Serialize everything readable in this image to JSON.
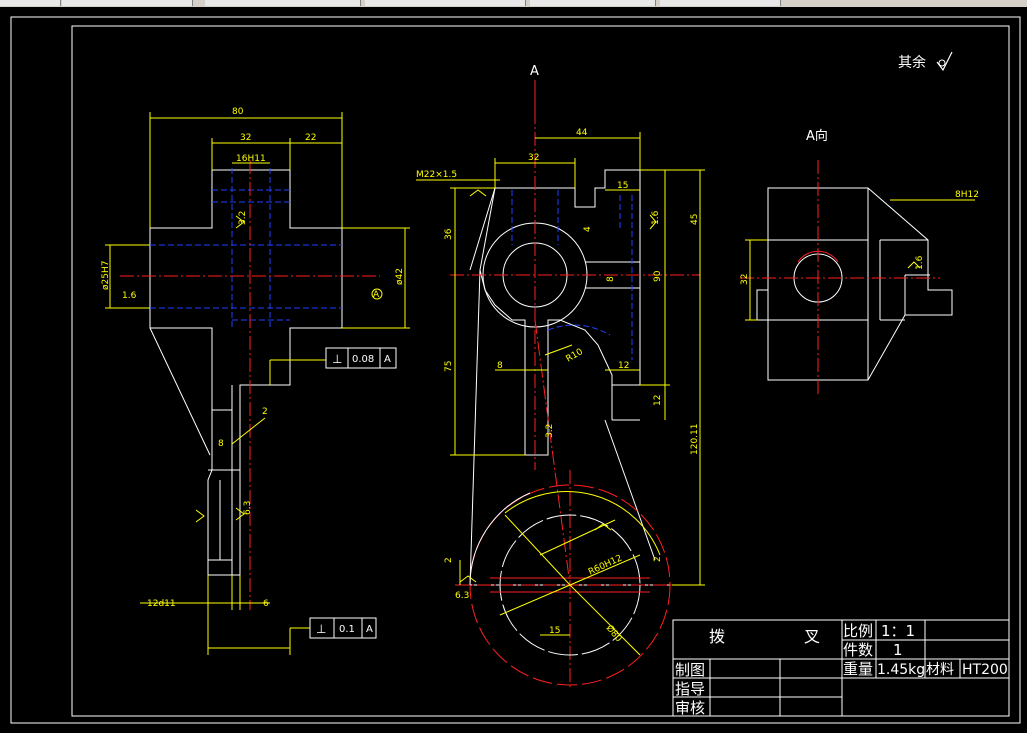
{
  "toolbar": {
    "visible": true
  },
  "drawing": {
    "roughness_note": "其余",
    "view_a_marker": "A",
    "view_a_label": "A向",
    "left_view": {
      "dims": [
        "80",
        "32",
        "22",
        "16H11",
        "ø25H7",
        "1.6",
        "ø42",
        "A",
        "2",
        "8",
        "12d11",
        "6",
        "3.2",
        "6.3"
      ],
      "tol1": {
        "symbol": "⊥",
        "value": "0.08",
        "datum": "A"
      },
      "tol2": {
        "symbol": "⊥",
        "value": "0.1",
        "datum": "A"
      }
    },
    "front_view": {
      "dims": [
        "M22×1.5",
        "32",
        "44",
        "15",
        "36",
        "45",
        "90",
        "4",
        "8",
        "75",
        "8",
        "12",
        "12",
        "R10",
        "120.11",
        "2",
        "15",
        "R60H12",
        "Ø80",
        "2",
        "3.2",
        "6.3",
        "1.6"
      ]
    },
    "side_view": {
      "dims": [
        "8H12",
        "32",
        "1.6"
      ]
    },
    "title_block": {
      "part_name_1": "拨",
      "part_name_2": "叉",
      "scale_label": "比例",
      "scale_value": "1：1",
      "qty_label": "件数",
      "qty_value": "1",
      "weight_label": "重量",
      "weight_value": "1.45kg",
      "material_label": "材料",
      "material_value": "HT200",
      "drawn_label": "制图",
      "guide_label": "指导",
      "check_label": "审核"
    }
  },
  "colors": {
    "outline": "#ffffff",
    "dimension": "#ffff00",
    "centerline": "#ff0000",
    "hidden": "#0000ff"
  }
}
